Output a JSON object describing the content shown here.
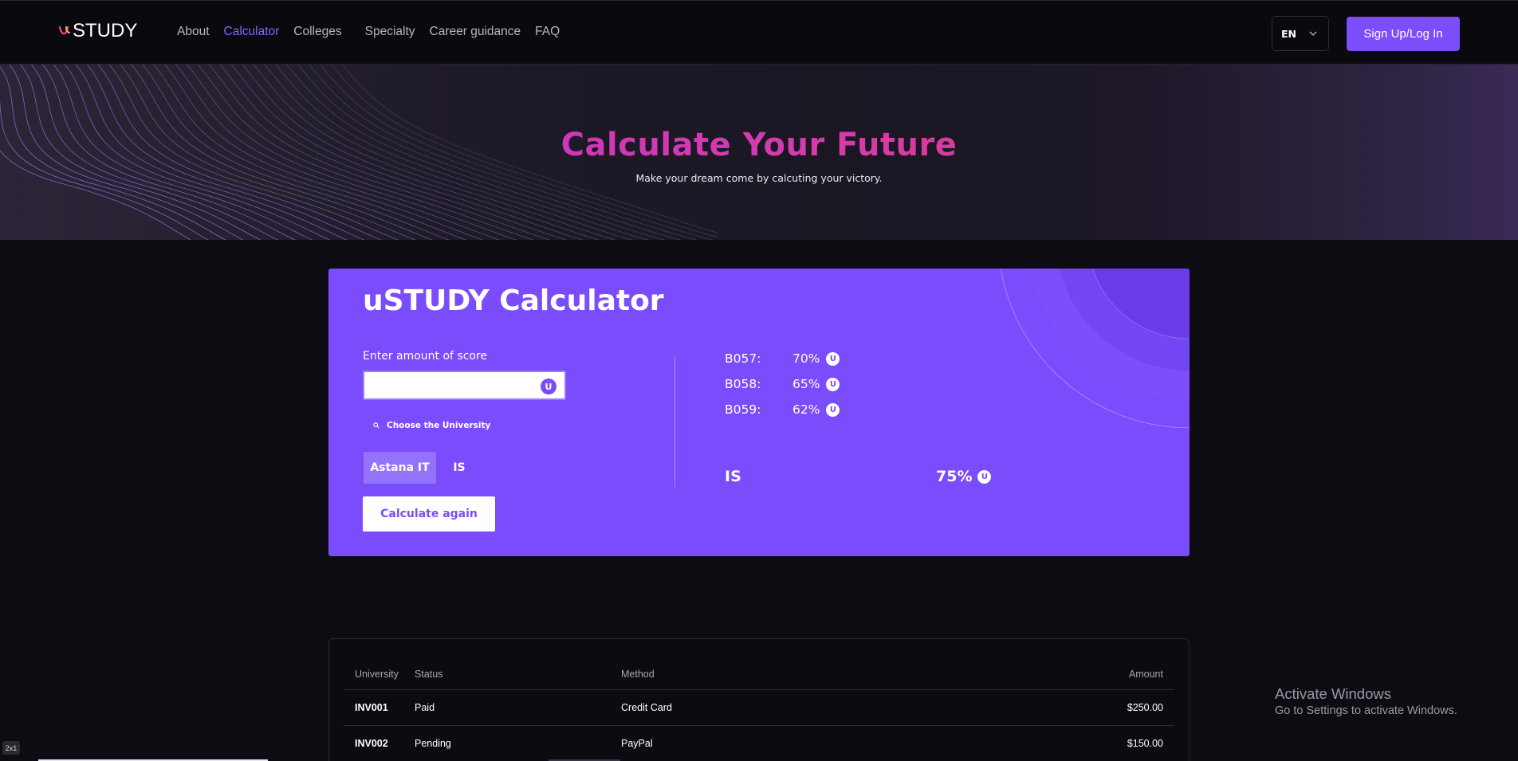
{
  "nav": {
    "logo_text": "STUDY",
    "links": [
      "About",
      "Calculator",
      "Colleges",
      "Specialty",
      "Career guidance",
      "FAQ"
    ],
    "active_link": "Calculator",
    "language": "EN",
    "signup_label": "Sign Up/Log In"
  },
  "hero": {
    "title": "Calculate Your Future",
    "subtitle": "Make your dream come by calcuting your victory."
  },
  "calculator": {
    "title": "uSTUDY Calculator",
    "score_label": "Enter amount of score",
    "score_value": "",
    "badge_letter": "U",
    "choose_label": "Choose the University",
    "universities": [
      "Astana IT",
      "IS"
    ],
    "selected_university": "Astana IT",
    "calc_button": "Calculate again",
    "results": [
      {
        "code": "B057:",
        "percent": "70%"
      },
      {
        "code": "B058:",
        "percent": "65%"
      },
      {
        "code": "B059:",
        "percent": "62%"
      }
    ],
    "summary": {
      "name": "IS",
      "percent": "75%"
    }
  },
  "table": {
    "headers": [
      "University",
      "Status",
      "Method",
      "Amount"
    ],
    "rows": [
      {
        "university": "INV001",
        "status": "Paid",
        "method": "Credit Card",
        "amount": "$250.00"
      },
      {
        "university": "INV002",
        "status": "Pending",
        "method": "PayPal",
        "amount": "$150.00"
      }
    ]
  },
  "overlay": {
    "activate_title": "Activate Windows",
    "activate_sub": "Go to Settings to activate Windows.",
    "zoom_badge": "2x1"
  },
  "colors": {
    "accent": "#7a4cfb",
    "background": "#0d0c12",
    "title_gradient_start": "#c22ad4",
    "title_gradient_end": "#e33a6f"
  }
}
